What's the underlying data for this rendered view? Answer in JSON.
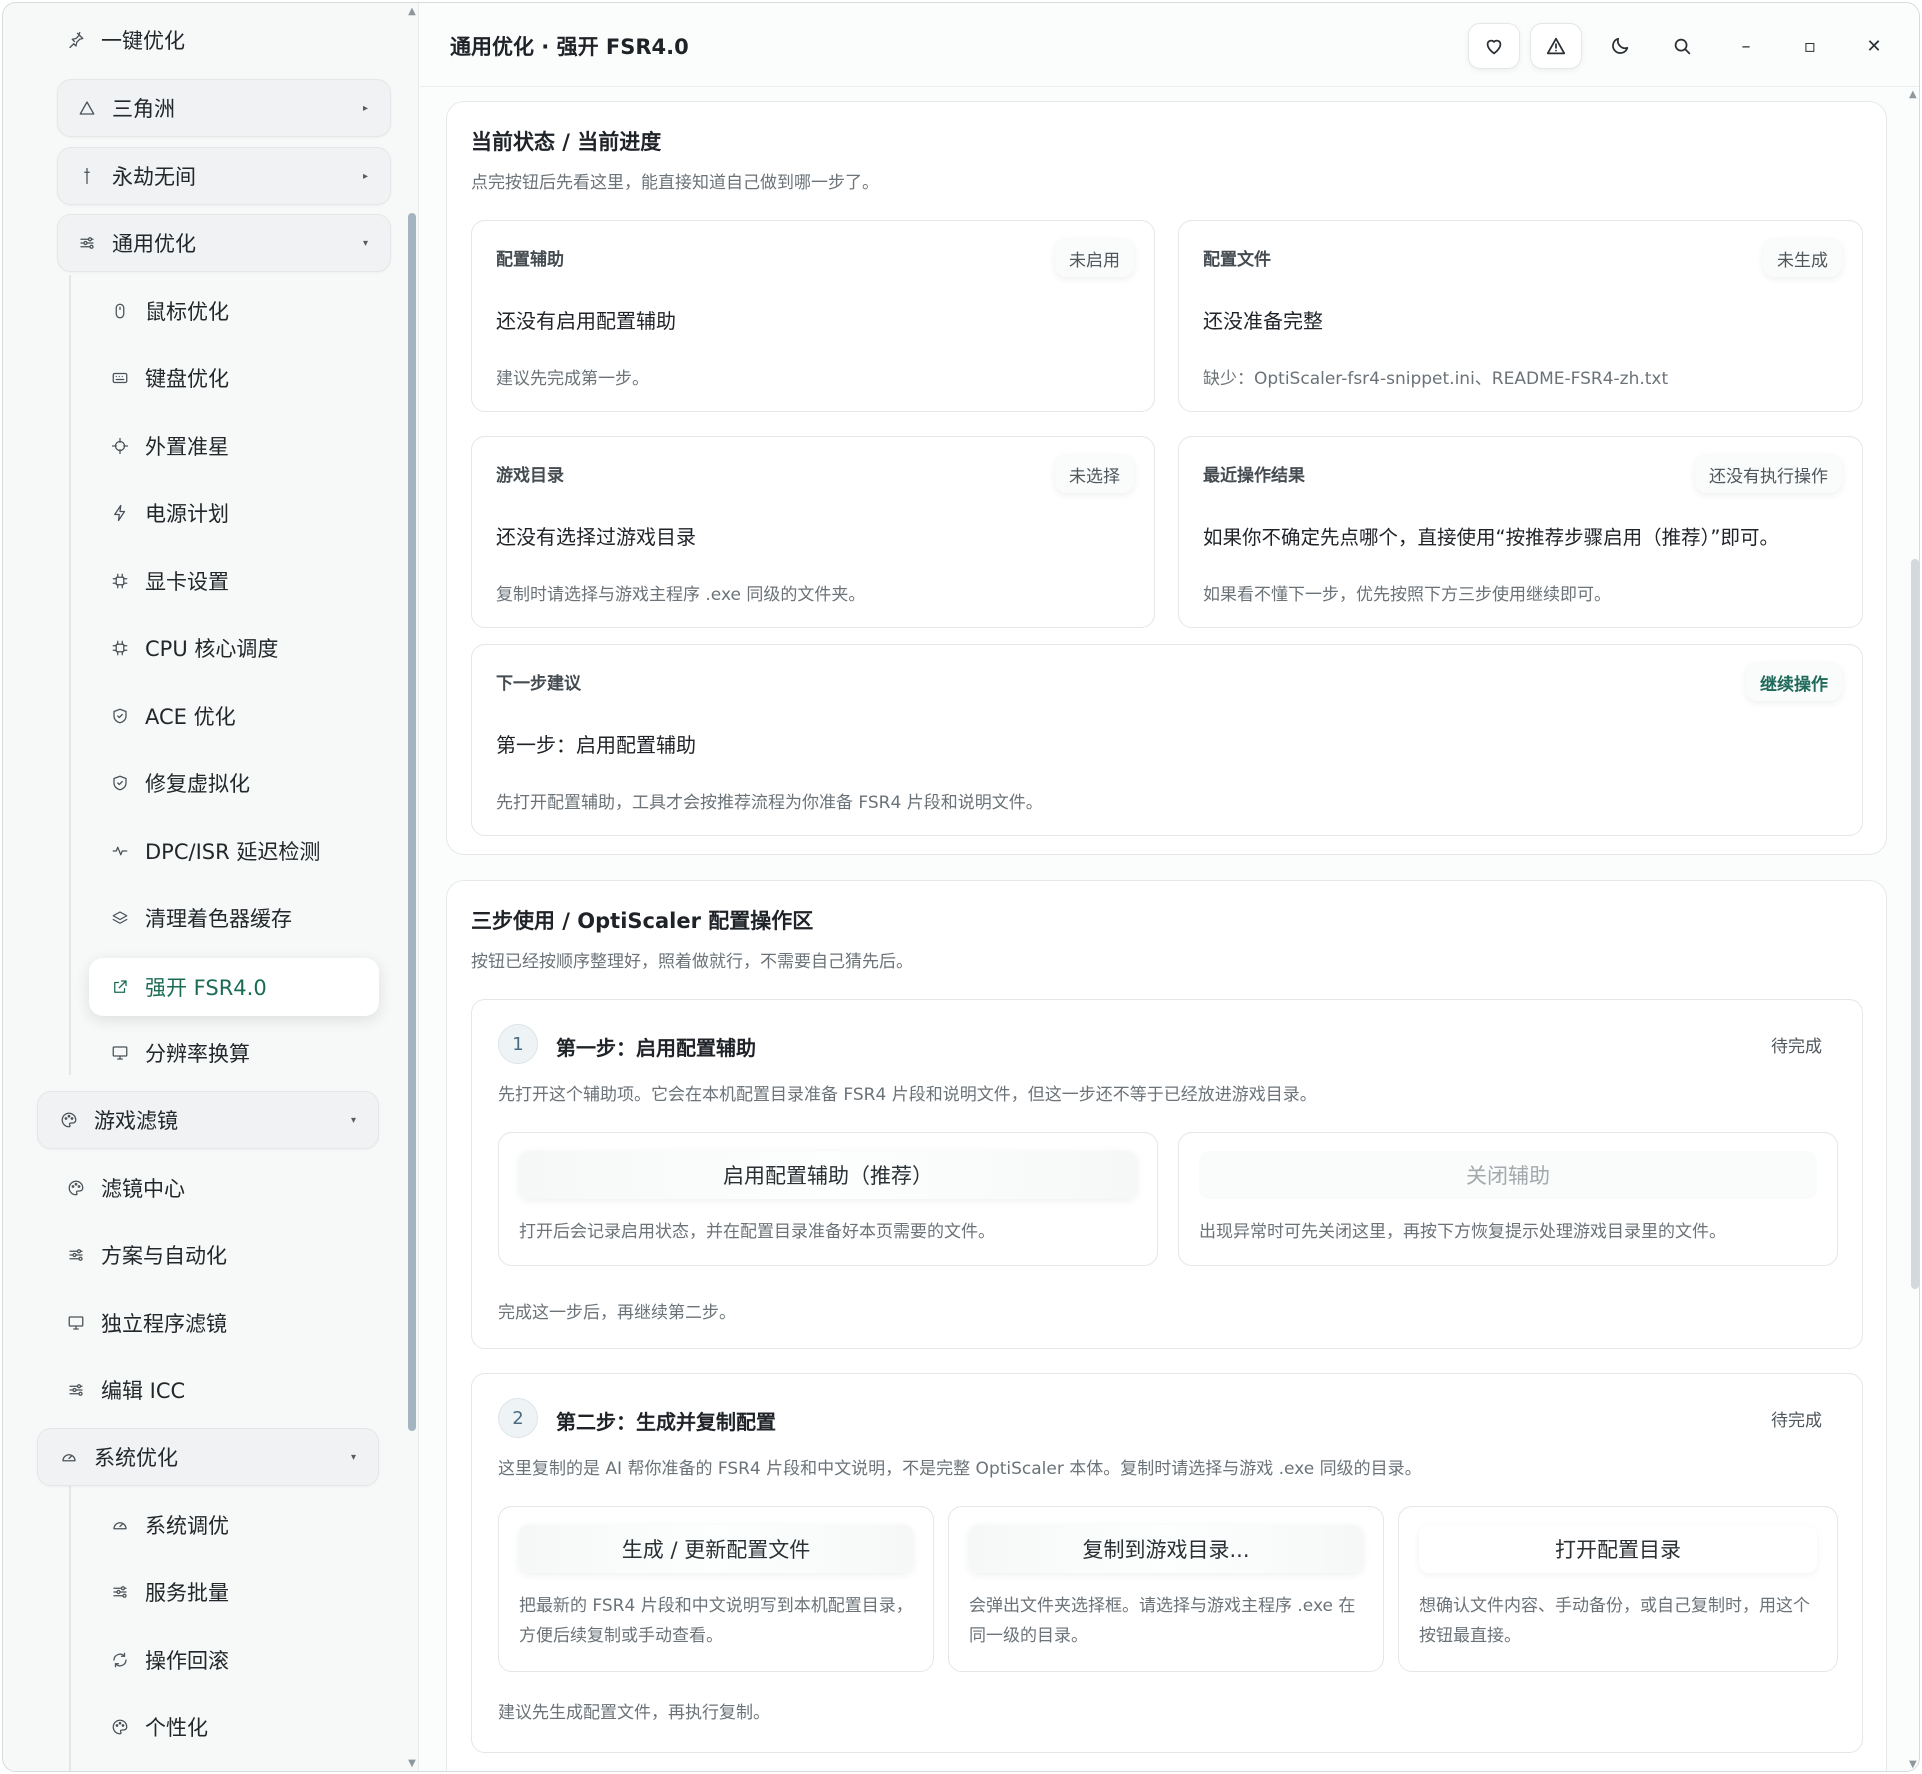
{
  "sidebar": {
    "top_item": "一键优化",
    "groups": [
      {
        "label": "三角洲"
      },
      {
        "label": "永劫无间"
      },
      {
        "label": "通用优化"
      }
    ],
    "general_items": [
      {
        "label": "鼠标优化"
      },
      {
        "label": "键盘优化"
      },
      {
        "label": "外置准星"
      },
      {
        "label": "电源计划"
      },
      {
        "label": "显卡设置"
      },
      {
        "label": "CPU 核心调度"
      },
      {
        "label": "ACE 优化"
      },
      {
        "label": "修复虚拟化"
      },
      {
        "label": "DPC/ISR 延迟检测"
      },
      {
        "label": "清理着色器缓存"
      },
      {
        "label": "强开 FSR4.0"
      },
      {
        "label": "分辨率换算"
      }
    ],
    "filter_group": "游戏滤镜",
    "filter_items": [
      {
        "label": "滤镜中心"
      },
      {
        "label": "方案与自动化"
      },
      {
        "label": "独立程序滤镜"
      },
      {
        "label": "编辑 ICC"
      }
    ],
    "system_group": "系统优化",
    "system_items": [
      {
        "label": "系统调优"
      },
      {
        "label": "服务批量"
      },
      {
        "label": "操作回滚"
      },
      {
        "label": "个性化"
      }
    ]
  },
  "header": {
    "title": "通用优化 · 强开 FSR4.0",
    "minimize": "–",
    "maximize": "▫",
    "close": "✕"
  },
  "status_panel": {
    "title": "当前状态 / 当前进度",
    "subtitle": "点完按钮后先看这里，能直接知道自己做到哪一步了。",
    "cards": [
      {
        "label": "配置辅助",
        "badge": "未启用",
        "main": "还没有启用配置辅助",
        "hint": "建议先完成第一步。"
      },
      {
        "label": "配置文件",
        "badge": "未生成",
        "main": "还没准备完整",
        "hint": "缺少：OptiScaler-fsr4-snippet.ini、README-FSR4-zh.txt"
      },
      {
        "label": "游戏目录",
        "badge": "未选择",
        "main": "还没有选择过游戏目录",
        "hint": "复制时请选择与游戏主程序 .exe 同级的文件夹。"
      },
      {
        "label": "最近操作结果",
        "badge": "还没有执行操作",
        "main": "如果你不确定先点哪个，直接使用“按推荐步骤启用（推荐）”即可。",
        "hint": "如果看不懂下一步，优先按照下方三步使用继续即可。"
      }
    ],
    "next": {
      "label": "下一步建议",
      "badge": "继续操作",
      "main": "第一步：启用配置辅助",
      "hint": "先打开配置辅助，工具才会按推荐流程为你准备 FSR4 片段和说明文件。"
    }
  },
  "steps_panel": {
    "title": "三步使用 / OptiScaler 配置操作区",
    "subtitle": "按钮已经按顺序整理好，照着做就行，不需要自己猜先后。",
    "step1": {
      "num": "1",
      "title": "第一步：启用配置辅助",
      "status": "待完成",
      "desc": "先打开这个辅助项。它会在本机配置目录准备 FSR4 片段和说明文件，但这一步还不等于已经放进游戏目录。",
      "actions": [
        {
          "label": "启用配置辅助（推荐）",
          "desc": "打开后会记录启用状态，并在配置目录准备好本页需要的文件。"
        },
        {
          "label": "关闭辅助",
          "desc": "出现异常时可先关闭这里，再按下方恢复提示处理游戏目录里的文件。"
        }
      ],
      "foot": "完成这一步后，再继续第二步。"
    },
    "step2": {
      "num": "2",
      "title": "第二步：生成并复制配置",
      "status": "待完成",
      "desc": "这里复制的是 AI 帮你准备的 FSR4 片段和中文说明，不是完整 OptiScaler 本体。复制时请选择与游戏 .exe 同级的目录。",
      "actions": [
        {
          "label": "生成 / 更新配置文件",
          "desc": "把最新的 FSR4 片段和中文说明写到本机配置目录，方便后续复制或手动查看。"
        },
        {
          "label": "复制到游戏目录...",
          "desc": "会弹出文件夹选择框。请选择与游戏主程序 .exe 在同一级的目录。"
        },
        {
          "label": "打开配置目录",
          "desc": "想确认文件内容、手动备份，或自己复制时，用这个按钮最直接。"
        }
      ],
      "foot": "建议先生成配置文件，再执行复制。"
    }
  }
}
